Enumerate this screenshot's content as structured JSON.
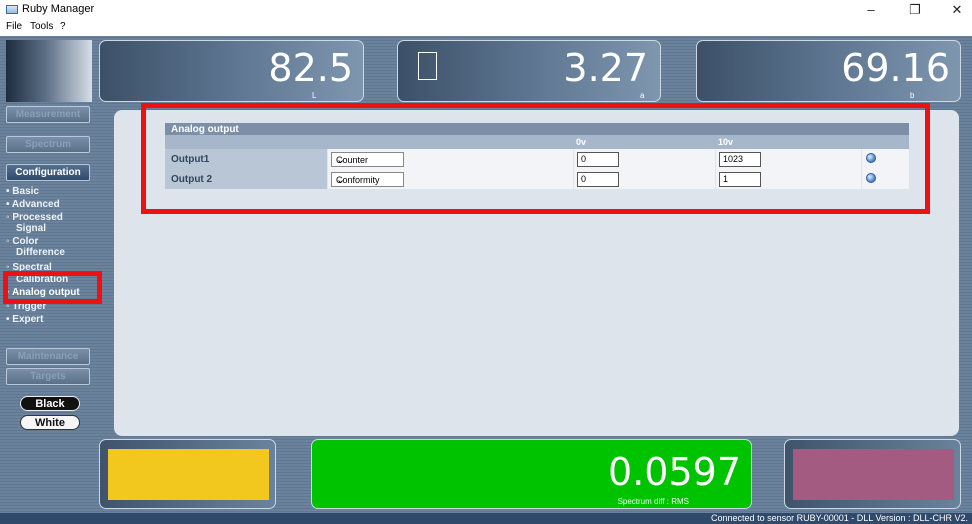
{
  "window": {
    "title": "Ruby Manager",
    "minimize": "–",
    "maximize": "❐",
    "close": "✕"
  },
  "menu": [
    "File",
    "Tools",
    "?"
  ],
  "readouts": {
    "L": {
      "value": "82.5",
      "label": "L"
    },
    "a": {
      "value": "3.27",
      "label": "a"
    },
    "b": {
      "value": "69.16",
      "label": "b"
    }
  },
  "sidebar": {
    "measurement": "Measurement",
    "spectrum": "Spectrum",
    "configuration": "Configuration",
    "tree": [
      {
        "label": "• Basic"
      },
      {
        "label": "• Advanced"
      },
      {
        "label": "◦ Processed"
      },
      {
        "label": "Signal"
      },
      {
        "label": "◦ Color"
      },
      {
        "label": "Difference"
      },
      {
        "label": "◦ Spectral"
      },
      {
        "label": "Calibration"
      },
      {
        "label": "◦ Analog output"
      },
      {
        "label": "◦ Trigger"
      },
      {
        "label": "• Expert"
      }
    ],
    "maintenance": "Maintenance",
    "targets": "Targets",
    "black": "Black",
    "white": "White"
  },
  "analog_output": {
    "title": "Analog output",
    "columns": [
      "",
      "",
      "0v",
      "10v",
      ""
    ],
    "rows": [
      {
        "label": "Output1",
        "mode": "Counter",
        "v0": "0",
        "v10": "1023"
      },
      {
        "label": "Output 2",
        "mode": "Conformity",
        "v0": "0",
        "v10": "1"
      }
    ]
  },
  "bottom": {
    "result_value": "0.0597",
    "result_label": "Spectrum diff : RMS",
    "colors": {
      "reference": "#f2c81f",
      "result": "#00c300",
      "sample": "#a35b82"
    }
  },
  "status": "Connected to sensor RUBY-00001 - DLL Version : DLL-CHR V2.",
  "icons": {
    "app": "app-icon",
    "dropdown": "chevron-down-icon",
    "info": "info-icon"
  }
}
